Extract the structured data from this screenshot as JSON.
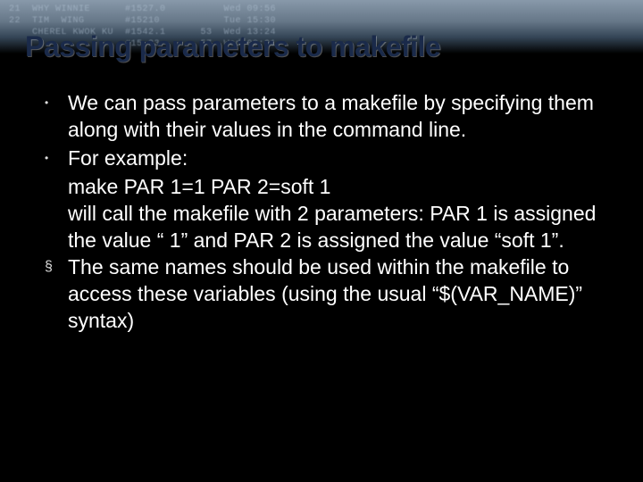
{
  "banner_text": "21  WHY WINNIE      #1527.0          Wed 09:56\n22  TIM  WING       #15210           Tue 15:30\n    CHEREL KWOK KU  #1542.1      53  Wed 13:24\n                    #15.23       57  Wed 09:01",
  "title": "Passing parameters to makefile",
  "bullets": [
    {
      "style": "dot",
      "lines": [
        "We can pass parameters to a makefile by specifying them along with their values in the command line."
      ]
    },
    {
      "style": "dot",
      "lines": [
        "For example:",
        "make PAR 1=1 PAR 2=soft 1",
        "will call the makefile with 2 parameters: PAR 1 is assigned the value “ 1” and PAR 2 is assigned the value “soft 1”."
      ]
    },
    {
      "style": "square",
      "lines": [
        "The same names should be used within the makefile to access these variables (using the usual “$(VAR_NAME)” syntax)"
      ]
    }
  ]
}
